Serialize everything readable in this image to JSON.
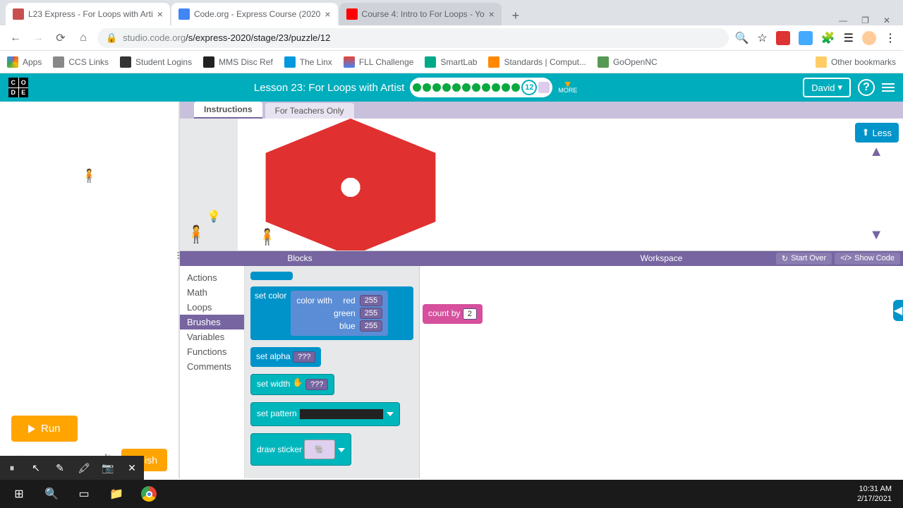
{
  "browser": {
    "tabs": [
      {
        "title": "L23 Express - For Loops with Arti",
        "fav": "#c94f4f"
      },
      {
        "title": "Code.org - Express Course (2020",
        "fav": "#4285f4"
      },
      {
        "title": "Course 4: Intro to For Loops - Yo",
        "fav": "#ff0000"
      }
    ],
    "url_host": "studio.code.org",
    "url_path": "/s/express-2020/stage/23/puzzle/12",
    "window_controls": {
      "min": "—",
      "max": "❐",
      "close": "✕"
    }
  },
  "bookmarks": [
    "Apps",
    "CCS Links",
    "Student Logins",
    "MMS Disc Ref",
    "The Linx",
    "FLL Challenge",
    "SmartLab",
    "Standards | Comput...",
    "GoOpenNC"
  ],
  "other_bookmarks": "Other bookmarks",
  "header": {
    "lesson": "Lesson 23: For Loops with Artist",
    "current_puzzle": "12",
    "progress_done": 11,
    "more": "MORE",
    "user": "David"
  },
  "tabs": {
    "instructions": "Instructions",
    "teachers": "For Teachers Only"
  },
  "less_btn": "Less",
  "panels": {
    "blocks": "Blocks",
    "workspace": "Workspace",
    "start_over": "Start Over",
    "show_code": "Show Code"
  },
  "controls": {
    "run": "Run",
    "finish": "Finish"
  },
  "categories": [
    "Actions",
    "Math",
    "Loops",
    "Brushes",
    "Variables",
    "Functions",
    "Comments"
  ],
  "selected_category": "Brushes",
  "blocks": {
    "set_color": "set color",
    "color_with": "color with",
    "red": "red",
    "green": "green",
    "blue": "blue",
    "rgb_vals": [
      "255",
      "255",
      "255"
    ],
    "set_alpha": "set alpha",
    "alpha_val": "???",
    "set_width": "set width",
    "width_val": "???",
    "set_pattern": "set pattern",
    "draw_sticker": "draw sticker",
    "count_by": "count by",
    "count_val": "2"
  },
  "system": {
    "time": "10:31 AM",
    "date": "2/17/2021"
  }
}
